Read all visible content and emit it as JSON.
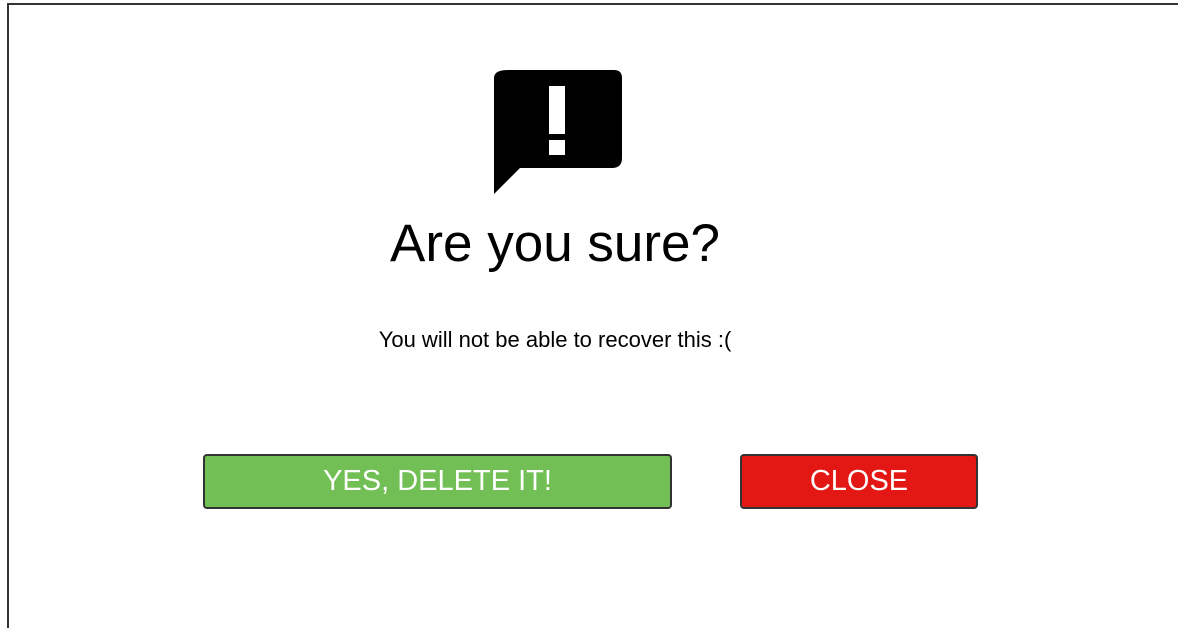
{
  "dialog": {
    "icon": "exclamation-speech-bubble-icon",
    "title": "Are you sure?",
    "message": "You will not be able to recover this :(",
    "confirm_button_label": "YES, DELETE IT!",
    "close_button_label": "CLOSE"
  },
  "colors": {
    "confirm_button": "#72bf55",
    "close_button": "#e31713",
    "icon": "#000000",
    "text": "#000000",
    "button_text": "#ffffff"
  }
}
